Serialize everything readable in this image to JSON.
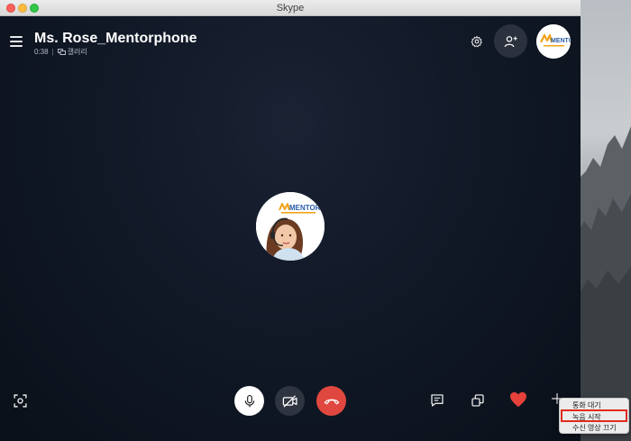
{
  "window": {
    "title": "Skype"
  },
  "call": {
    "contact_name": "Ms. Rose_Mentorphone",
    "duration": "0:38",
    "separator": "|",
    "view_mode": "갤러리"
  },
  "avatars": {
    "logo_text": "MENTOR"
  },
  "context_menu": {
    "items": [
      {
        "label": "통화 대기"
      },
      {
        "label": "녹음 시작"
      },
      {
        "label": "수신 영상 끄기"
      }
    ],
    "highlighted_index": 1
  },
  "colors": {
    "call_background": "#0f1622",
    "hangup": "#e0483f",
    "heart": "#e5403a",
    "highlight_border": "#e02a1f"
  },
  "icons": {
    "menu": "hamburger-menu-icon",
    "settings": "gear-icon",
    "add_person": "add-person-icon",
    "screen_share": "screen-share-icon",
    "mic": "microphone-icon",
    "video_off": "video-off-icon",
    "hangup": "phone-hangup-icon",
    "chat": "chat-icon",
    "switch": "switch-window-icon",
    "react": "heart-icon",
    "more": "plus-icon"
  }
}
